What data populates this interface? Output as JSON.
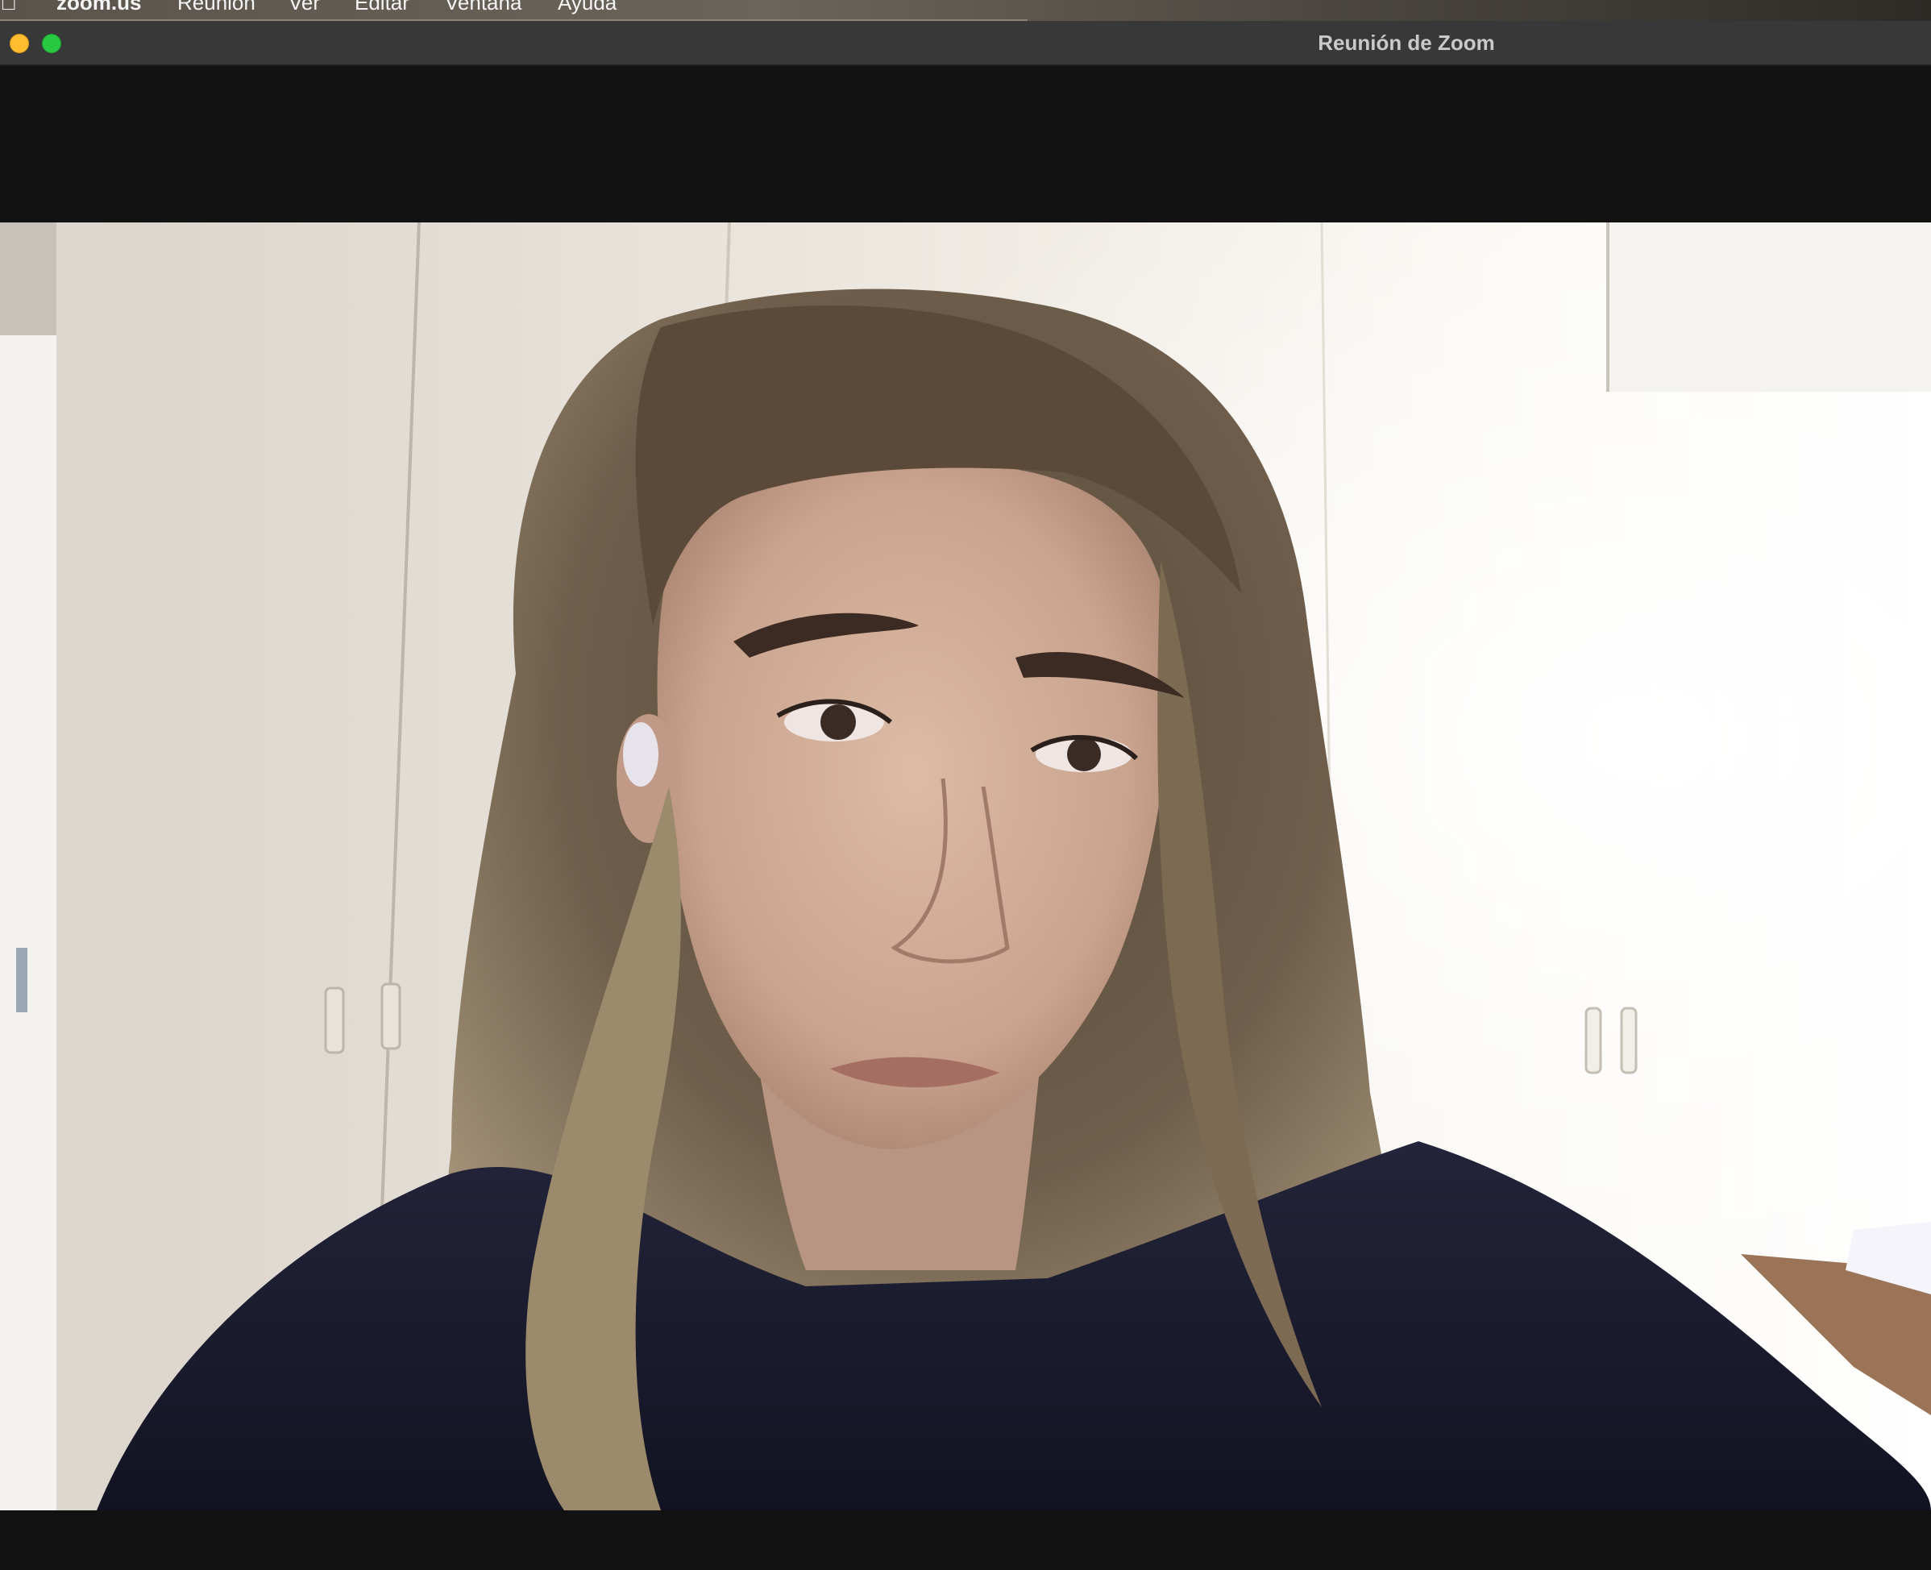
{
  "menubar": {
    "apple_icon": "apple-logo-icon",
    "items": [
      "zoom.us",
      "Reunión",
      "Ver",
      "Editar",
      "Ventana",
      "Ayuda"
    ]
  },
  "window": {
    "title": "Reunión de Zoom"
  },
  "colors": {
    "window_background": "#121212",
    "titlebar": "#383838",
    "minimize_button": "#febc2e",
    "zoom_button": "#28c840"
  },
  "video": {
    "participant_feed": "participant-video-feed"
  }
}
